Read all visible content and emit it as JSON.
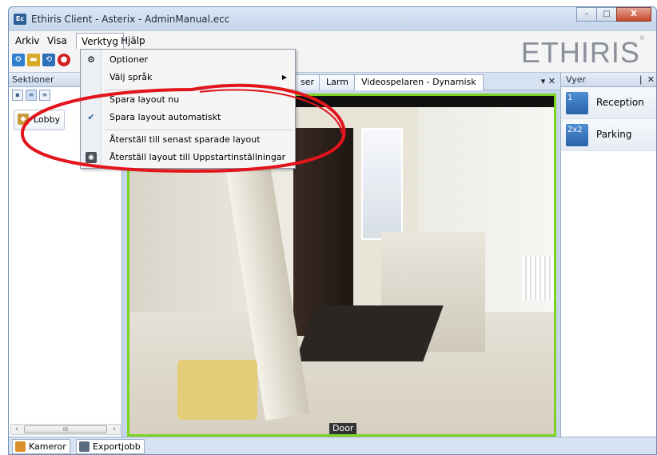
{
  "window": {
    "title": "Ethiris Client - Asterix - AdminManual.ecc",
    "app_icon_text": "Ec",
    "controls": [
      "–",
      "□",
      "X"
    ]
  },
  "menubar": {
    "items": [
      "Arkiv",
      "Visa",
      "Verktyg",
      "Hjälp"
    ],
    "open_item": "Verktyg"
  },
  "logo": {
    "text": "ETHIRIS"
  },
  "left_panel": {
    "title": "Sektioner",
    "items": [
      {
        "label": "Lobby"
      }
    ]
  },
  "tabs": {
    "items": [
      "ser",
      "Larm",
      "Videospelaren - Dynamisk"
    ],
    "controls": "▾ ✕"
  },
  "video": {
    "caption": "Door"
  },
  "right_panel": {
    "title": "Vyer",
    "controls": "❘ ✕",
    "views": [
      {
        "label": "Reception",
        "icon_text": "1"
      },
      {
        "label": "Parking",
        "icon_text": "2x2"
      }
    ]
  },
  "bottom_tabs": [
    "Kameror",
    "Exportjobb"
  ],
  "dropdown": {
    "items": [
      {
        "label": "Optioner",
        "icon": "gear-icon"
      },
      {
        "label": "Välj språk",
        "submenu": true
      },
      {
        "label": "Spara layout nu"
      },
      {
        "label": "Spara layout automatiskt",
        "checked": true
      },
      {
        "label": "Återställ till senast sparade layout"
      },
      {
        "label": "Återställ layout till Uppstartinställningar",
        "icon": "camera-icon"
      }
    ]
  },
  "colors": {
    "video_border": "#7ed321",
    "annotation": "#e2141c",
    "accent": "#2a62a8"
  }
}
